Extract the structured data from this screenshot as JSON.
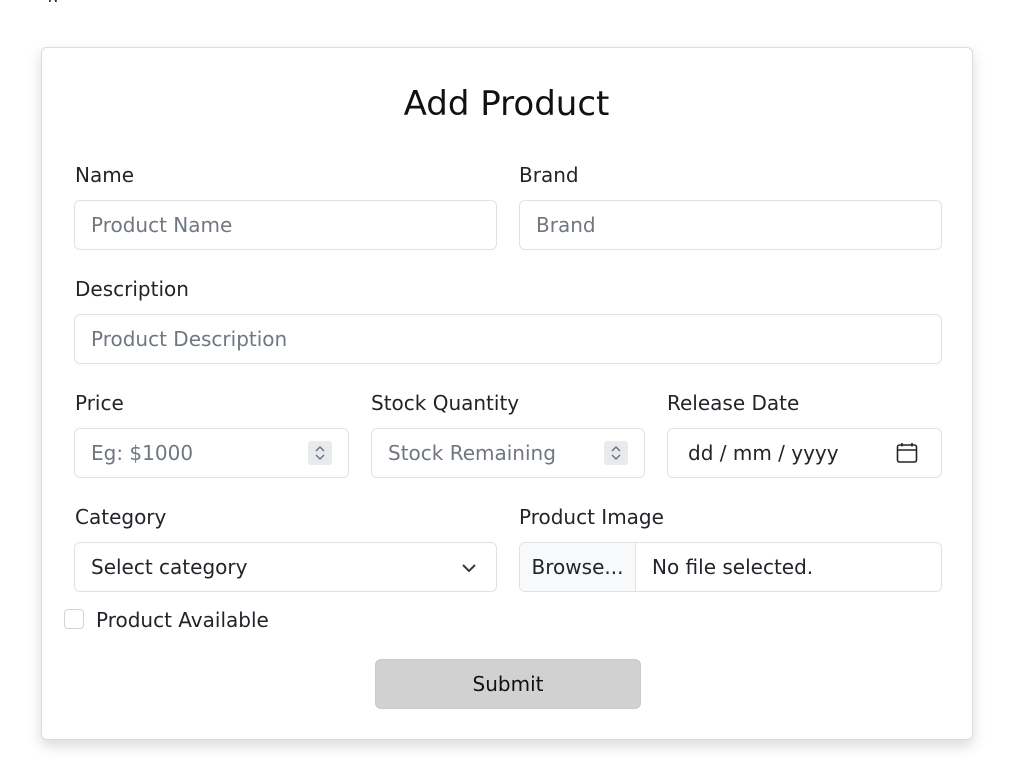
{
  "top_fragment": "g",
  "form": {
    "title": "Add Product",
    "name": {
      "label": "Name",
      "placeholder": "Product Name"
    },
    "brand": {
      "label": "Brand",
      "placeholder": "Brand"
    },
    "description": {
      "label": "Description",
      "placeholder": "Product Description"
    },
    "price": {
      "label": "Price",
      "placeholder": "Eg: $1000"
    },
    "stock": {
      "label": "Stock Quantity",
      "placeholder": "Stock Remaining"
    },
    "release_date": {
      "label": "Release Date",
      "value": "dd / mm / yyyy"
    },
    "category": {
      "label": "Category",
      "selected": "Select category"
    },
    "image": {
      "label": "Product Image",
      "button": "Browse...",
      "status": "No file selected."
    },
    "available": {
      "label": "Product Available",
      "checked": false
    },
    "submit_label": "Submit"
  },
  "icons": {
    "spinner": "spinner-arrows-icon",
    "calendar": "calendar-icon",
    "dropdown": "chevron-down-icon"
  },
  "colors": {
    "submit_bg": "#d1d1d1",
    "border": "#dee2e6",
    "placeholder": "#707780"
  }
}
